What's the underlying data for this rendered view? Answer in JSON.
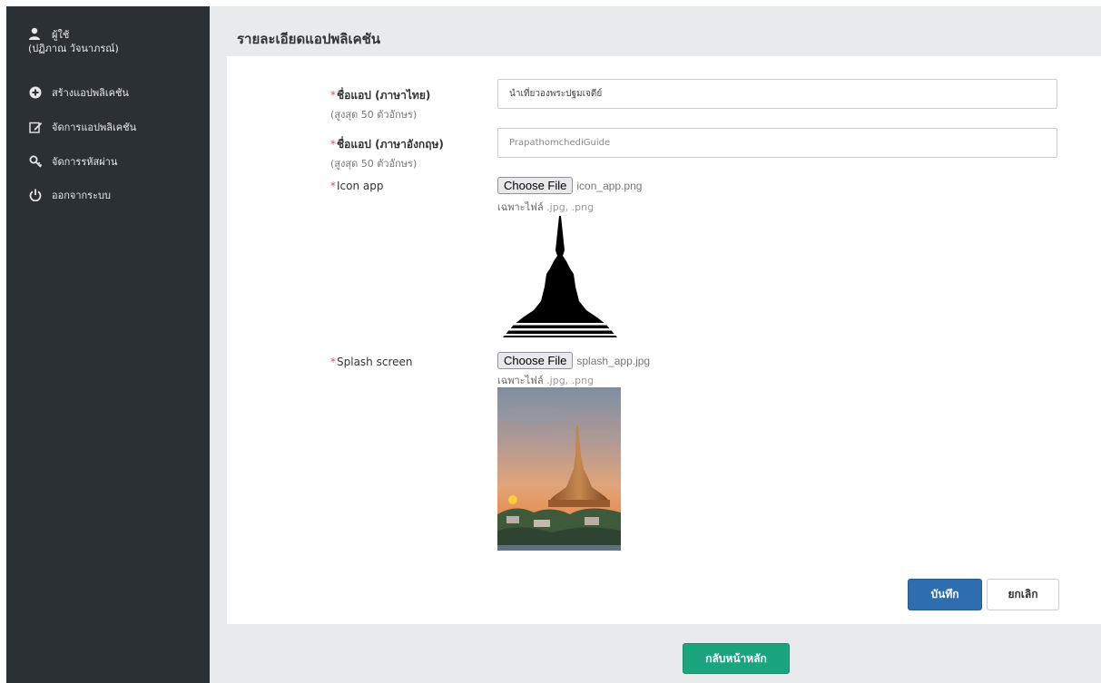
{
  "sidebar": {
    "user": {
      "role": "ผู้ใช้",
      "name": "(ปฏิภาณ วัจนาภรณ์)"
    },
    "items": [
      {
        "label": "สร้างแอปพลิเคชัน",
        "icon": "plus-circle-icon"
      },
      {
        "label": "จัดการแอปพลิเคชัน",
        "icon": "edit-icon"
      },
      {
        "label": "จัดการรหัสผ่าน",
        "icon": "key-icon"
      },
      {
        "label": "ออกจากระบบ",
        "icon": "power-icon"
      }
    ]
  },
  "page": {
    "title": "รายละเอียดแอปพลิเคชัน"
  },
  "form": {
    "required_mark": "*",
    "app_name_th": {
      "label": "ชื่อแอป (ภาษาไทย)",
      "hint": "(สูงสุด 50 ตัวอักษร)",
      "value": "นำเที่ยวองพระปฐมเจดีย์"
    },
    "app_name_en": {
      "label": "ชื่อแอป (ภาษาอังกฤษ)",
      "hint": "(สูงสุด 50 ตัวอักษร)",
      "value": "PrapathomchediGuide"
    },
    "icon_app": {
      "label": "Icon app",
      "button": "Choose File",
      "file_name": "icon_app.png",
      "hint_prefix": "เฉพาะไฟล์",
      "hint_ext": ".jpg, .png"
    },
    "splash_screen": {
      "label": "Splash screen",
      "button": "Choose File",
      "file_name": "splash_app.jpg",
      "hint_prefix": "เฉพาะไฟล์",
      "hint_ext": ".jpg, .png"
    }
  },
  "actions": {
    "save": "บันทึก",
    "cancel": "ยกเลิก",
    "home": "กลับหน้าหลัก"
  },
  "colors": {
    "sidebar": "#2b3035",
    "background": "#e9eaec",
    "primary": "#2e6eb0",
    "success": "#1aa57f",
    "required": "#d9534f"
  }
}
